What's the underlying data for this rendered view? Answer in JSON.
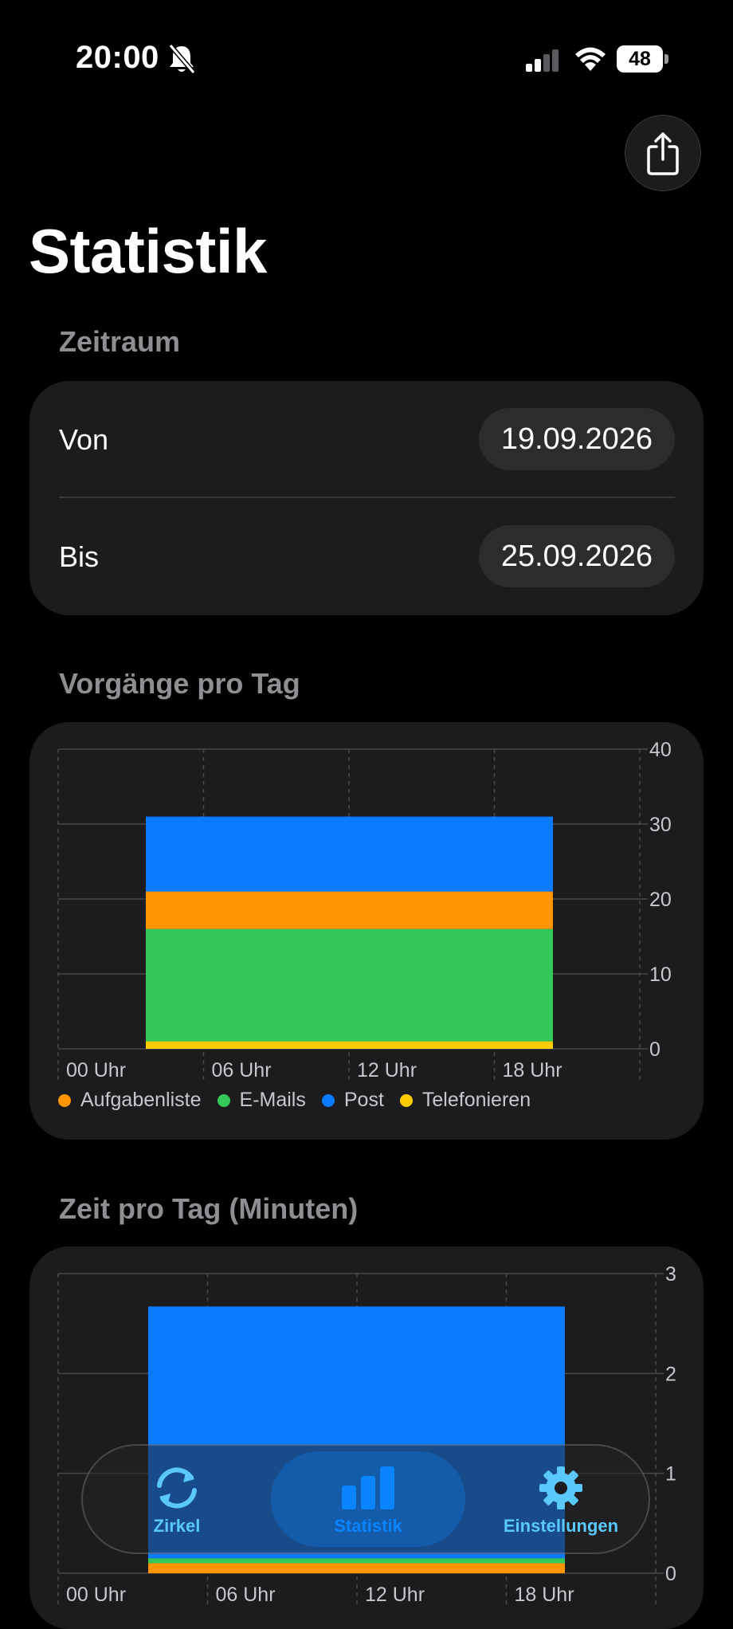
{
  "status_bar": {
    "time": "20:00",
    "battery": "48"
  },
  "page": {
    "title": "Statistik"
  },
  "zeitraum": {
    "header": "Zeitraum",
    "von_label": "Von",
    "von_value": "19.09.2026",
    "bis_label": "Bis",
    "bis_value": "25.09.2026"
  },
  "charts_headers": {
    "vorgaenge": "Vorgänge pro Tag",
    "zeit": "Zeit pro Tag (Minuten)"
  },
  "chart_data": [
    {
      "type": "bar",
      "title": "Vorgänge pro Tag",
      "x_ticks": [
        "00 Uhr",
        "06 Uhr",
        "12 Uhr",
        "18 Uhr"
      ],
      "y_ticks": [
        "0",
        "10",
        "20",
        "30",
        "40"
      ],
      "ylim": [
        0,
        40
      ],
      "stacked": true,
      "series": [
        {
          "name": "Telefonieren",
          "color": "#ffcc00",
          "value": 1
        },
        {
          "name": "E-Mails",
          "color": "#34c759",
          "value": 15
        },
        {
          "name": "Aufgabenliste",
          "color": "#ff9500",
          "value": 5
        },
        {
          "name": "Post",
          "color": "#0a7aff",
          "value": 10
        }
      ],
      "legend": [
        "Aufgabenliste",
        "E-Mails",
        "Post",
        "Telefonieren"
      ],
      "grid": true
    },
    {
      "type": "bar",
      "title": "Zeit pro Tag (Minuten)",
      "x_ticks": [
        "00 Uhr",
        "06 Uhr",
        "12 Uhr",
        "18 Uhr"
      ],
      "y_ticks": [
        "0",
        "1",
        "2",
        "3"
      ],
      "ylim": [
        0,
        3
      ],
      "stacked": true,
      "series": [
        {
          "name": "Aufgabenliste",
          "color": "#ff9500",
          "value": 0.1
        },
        {
          "name": "E-Mails",
          "color": "#34c759",
          "value": 0.05
        },
        {
          "name": "Post",
          "color": "#0a7aff",
          "value": 2.52
        }
      ],
      "grid": true
    }
  ],
  "tab_bar": {
    "items": [
      {
        "label": "Zirkel",
        "icon": "sync-icon"
      },
      {
        "label": "Statistik",
        "icon": "chart-bar-icon",
        "selected": true
      },
      {
        "label": "Einstellungen",
        "icon": "gear-icon"
      }
    ],
    "accent": "#5ac8fa",
    "selected_accent": "#0a84ff"
  }
}
